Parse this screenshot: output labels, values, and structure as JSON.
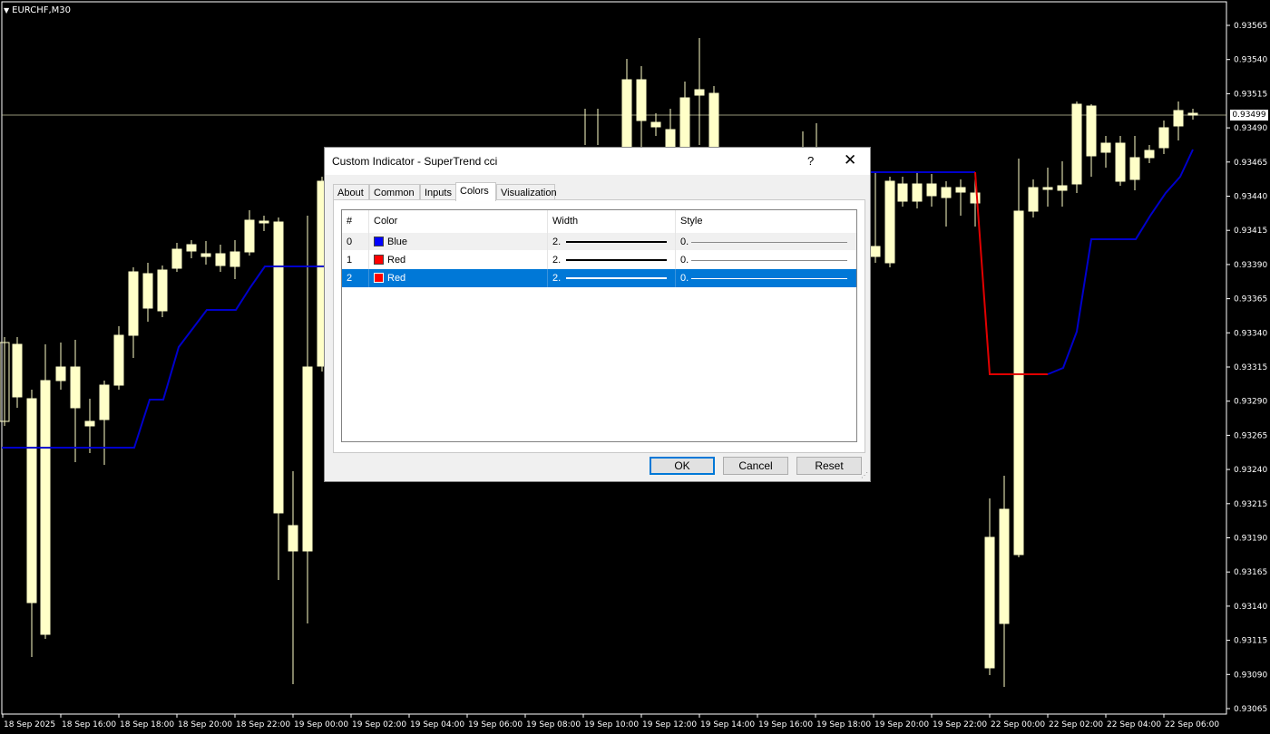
{
  "chart": {
    "symbol": "EURCHF,M30",
    "current_price": "0.93499",
    "price_axis": [
      "0.93565",
      "0.93540",
      "0.93515",
      "0.93490",
      "0.93465",
      "0.93440",
      "0.93415",
      "0.93390",
      "0.93365",
      "0.93340",
      "0.93315",
      "0.93290",
      "0.93265",
      "0.93240",
      "0.93215",
      "0.93190",
      "0.93165",
      "0.93140",
      "0.93115",
      "0.93090",
      "0.93065"
    ],
    "time_axis": [
      "18 Sep 2025",
      "18 Sep 16:00",
      "18 Sep 18:00",
      "18 Sep 20:00",
      "18 Sep 22:00",
      "19 Sep 00:00",
      "19 Sep 02:00",
      "19 Sep 04:00",
      "19 Sep 06:00",
      "19 Sep 08:00",
      "19 Sep 10:00",
      "19 Sep 12:00",
      "19 Sep 14:00",
      "19 Sep 16:00",
      "19 Sep 18:00",
      "19 Sep 20:00",
      "19 Sep 22:00",
      "22 Sep 00:00",
      "22 Sep 02:00",
      "22 Sep 04:00",
      "22 Sep 06:00"
    ],
    "colors": {
      "background": "#000000",
      "candle": "#ffffc8",
      "supertrend_up": "#0000cc",
      "supertrend_down": "#e10000",
      "grid_line": "#c8c8a0"
    }
  },
  "dialog": {
    "title": "Custom Indicator - SuperTrend cci",
    "help_label": "?",
    "close_label": "✕",
    "tabs": [
      "About",
      "Common",
      "Inputs",
      "Colors",
      "Visualization"
    ],
    "active_tab": "Colors",
    "columns": [
      "#",
      "Color",
      "Width",
      "Style"
    ],
    "rows": [
      {
        "index": "0",
        "color_name": "Blue",
        "color": "#0000ff",
        "width": "2.",
        "style": "0."
      },
      {
        "index": "1",
        "color_name": "Red",
        "color": "#ff0000",
        "width": "2.",
        "style": "0."
      },
      {
        "index": "2",
        "color_name": "Red",
        "color": "#ff0000",
        "width": "2.",
        "style": "0."
      }
    ],
    "selected_row": "2",
    "buttons": {
      "ok": "OK",
      "cancel": "Cancel",
      "reset": "Reset"
    }
  }
}
